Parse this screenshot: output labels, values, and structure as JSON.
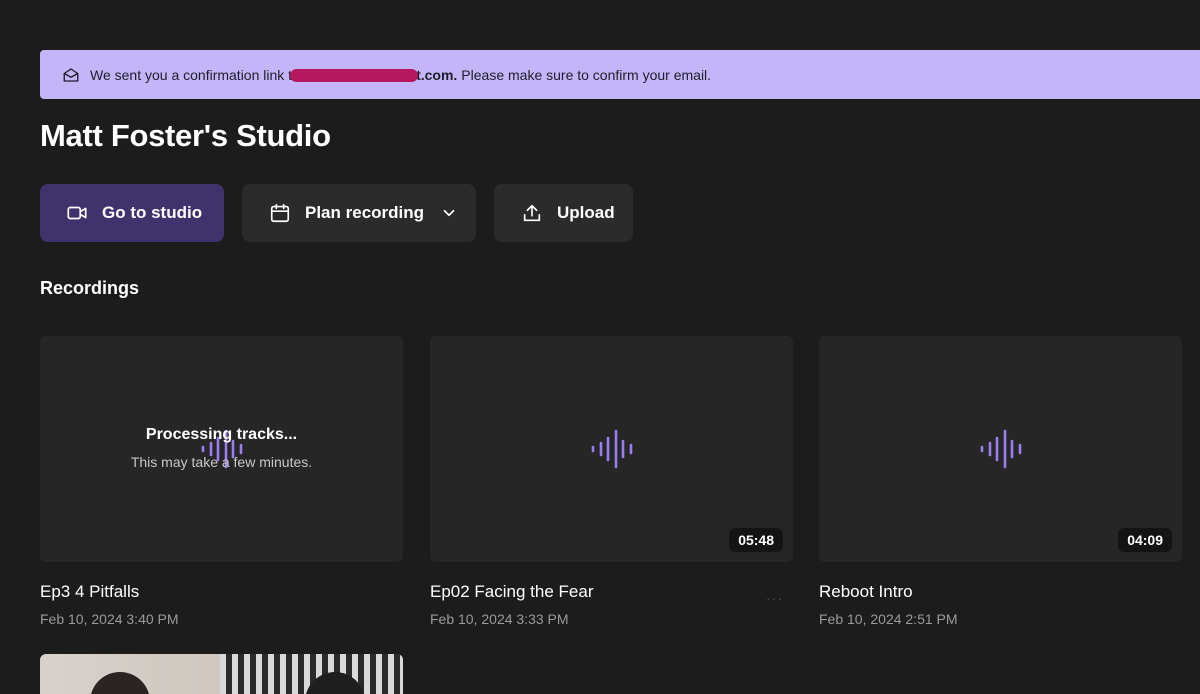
{
  "banner": {
    "text_before": "We sent you a confirmation link t",
    "email_suffix": "t.com.",
    "text_after": "Please make sure to confirm your email."
  },
  "page_title": "Matt Foster's Studio",
  "actions": {
    "studio_label": "Go to studio",
    "plan_label": "Plan recording",
    "upload_label": "Upload"
  },
  "section_title": "Recordings",
  "recordings": [
    {
      "title": "Ep3 4 Pitfalls",
      "date": "Feb 10, 2024 3:40 PM",
      "processing_title": "Processing tracks...",
      "processing_sub": "This may take a few minutes."
    },
    {
      "title": "Ep02 Facing the Fear",
      "date": "Feb 10, 2024 3:33 PM",
      "duration": "05:48"
    },
    {
      "title": "Reboot Intro",
      "date": "Feb 10, 2024 2:51 PM",
      "duration": "04:09"
    }
  ],
  "more_glyph": "···",
  "colors": {
    "background": "#1c1c1c",
    "banner": "#c4b5f8",
    "primary_button": "#40336d",
    "secondary_button": "#2b2b2b",
    "waveform": "#9b7df0"
  },
  "icons": {
    "banner": "mail-icon",
    "studio": "video-camera-icon",
    "plan": "calendar-icon",
    "plan_menu": "chevron-down-icon",
    "upload": "upload-icon",
    "thumbnail": "audio-waveform-icon"
  }
}
